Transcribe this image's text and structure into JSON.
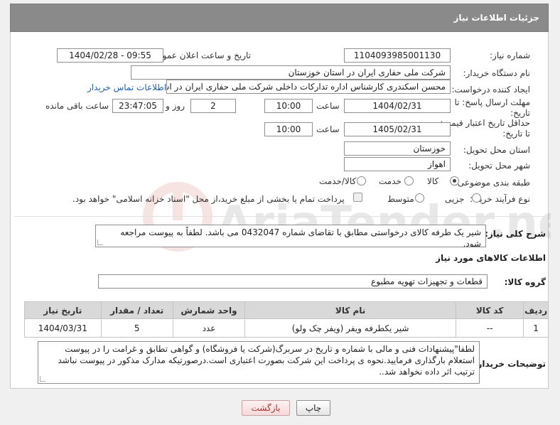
{
  "header": {
    "title": "جزئیات اطلاعات نیاز"
  },
  "need_number": {
    "label": "شماره نیاز:",
    "value": "1104093985001130"
  },
  "announce": {
    "label": "تاریخ و ساعت اعلان عمومی:",
    "value": "1404/02/28 - 09:55"
  },
  "buyer_org": {
    "label": "نام دستگاه خریدار:",
    "value": "شرکت ملی حفاری ایران در استان خوزستان"
  },
  "creator": {
    "label": "ایجاد کننده درخواست:",
    "value": "محسن اسکندری کارشناس اداره تدارکات داخلی  شرکت ملی حفاری ایران در اس",
    "contact_link": "اطلاعات تماس خریدار"
  },
  "reply_deadline": {
    "label_line1": "مهلت ارسال پاسخ: تا",
    "label_line2": "تاریخ:",
    "date": "1404/02/31",
    "time_label": "ساعت",
    "time": "10:00",
    "days": "2",
    "days_label": "روز و",
    "remaining": "23:47:05",
    "remaining_label": "ساعت باقی مانده"
  },
  "price_validity": {
    "label_line1": "حداقل تاریخ اعتبار قیمت:",
    "label_line2": "تا تاریخ:",
    "date": "1405/02/31",
    "time_label": "ساعت",
    "time": "10:00"
  },
  "delivery_province": {
    "label": "استان محل تحویل:",
    "value": "خوزستان"
  },
  "delivery_city": {
    "label": "شهر محل تحویل:",
    "value": "اهواز"
  },
  "category": {
    "label": "طبقه بندی موضوعی:",
    "options": [
      "کالا",
      "خدمت",
      "کالا/خدمت"
    ],
    "selected": "کالا"
  },
  "purchase_type": {
    "label": "نوع فرآیند خرید :",
    "options": [
      "جزیی",
      "متوسط"
    ],
    "selected": "جزیی",
    "payment_note": "پرداخت تمام یا بخشی از مبلغ خرید،از محل \"اسناد خزانه اسلامی\" خواهد بود."
  },
  "description": {
    "label": "شرح کلی نیاز:",
    "value": "شیر یک طرفه کالای درخواستی مطابق با تقاضای شماره 0432047  می باشد. لطفاً به پیوست مراجعه شود."
  },
  "goods_info": {
    "title": "اطلاعات کالاهای مورد نیاز"
  },
  "goods_group": {
    "label": "گروه کالا:",
    "value": "قطعات و تجهیزات تهویه مطبوع"
  },
  "table": {
    "columns": [
      "ردیف",
      "کد کالا",
      "نام کالا",
      "واحد شمارش",
      "تعداد / مقدار",
      "تاریخ نیاز"
    ],
    "rows": [
      [
        "1",
        "--",
        "شیر یکطرفه ویفر (ویفر چک ولو)",
        "عدد",
        "5",
        "1404/03/31"
      ]
    ]
  },
  "buyer_notes": {
    "label": "توضیحات خریدار:",
    "value": "لطفا\"پیشنهادات فنی و مالی با شماره و تاریخ در سربرگ(شرکت یا فروشگاه) و گواهی تطابق و غرامت را در پیوست استعلام بارگذاری فرمایید.نحوه ی پرداخت این شرکت بصورت اعتباری است.درصورتیکه مدارک مذکور در پیوست نباشد ترتیب اثر داده نخواهد شد.."
  },
  "buttons": {
    "print": "چاپ",
    "back": "بازگشت"
  },
  "watermark": {
    "text": "AriaTender.net"
  },
  "colors": {
    "header_bg": "#8a8a8a",
    "link": "#1e5faa",
    "back_button": "#a33333"
  }
}
